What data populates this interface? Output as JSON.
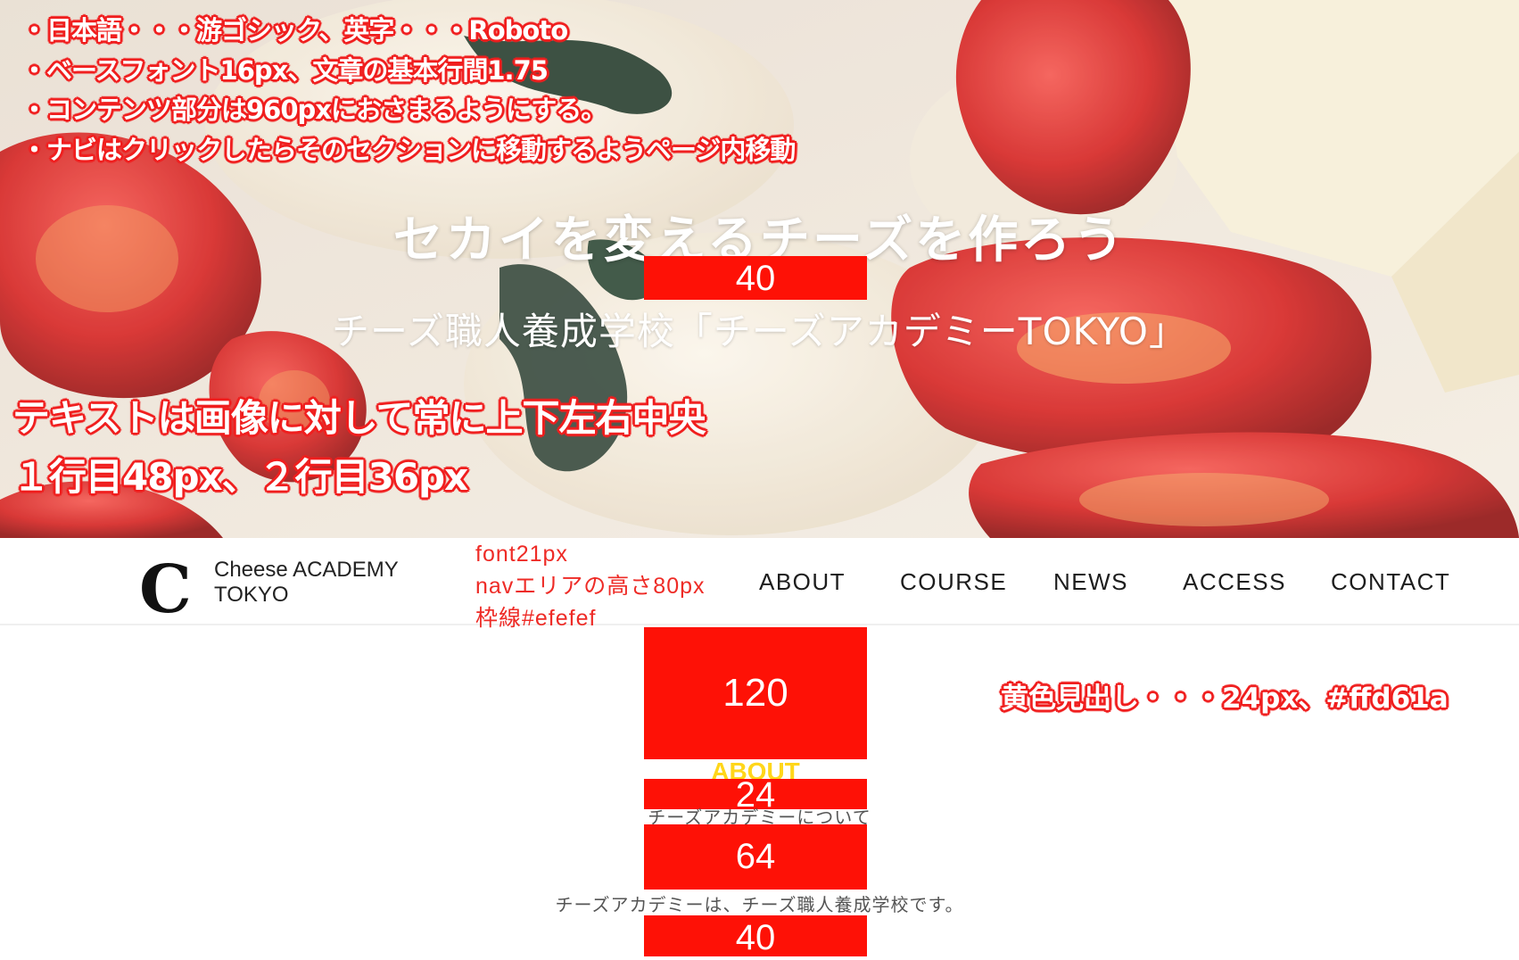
{
  "annotations": {
    "requirements": [
      "・日本語・・・游ゴシック、英字・・・Roboto",
      "・ベースフォント16px、文章の基本行間1.75",
      "・コンテンツ部分は960pxにおさまるようにする。",
      "・ナビはクリックしたらそのセクションに移動するようページ内移動"
    ],
    "hero_centering": [
      "テキストは画像に対して常に上下左右中央",
      "１行目48px、２行目36px"
    ],
    "nav_spec": [
      "font21px",
      "navエリアの高さ80px",
      "枠線#efefef"
    ],
    "heading_spec": "黄色見出し・・・24px、#ffd61a"
  },
  "hero": {
    "title": "セカイを変えるチーズを作ろう",
    "subtitle": "チーズ職人養成学校「チーズアカデミーTOKYO」"
  },
  "spacing_labels": {
    "hero_gap": "40",
    "section_top": "120",
    "heading_gap": "24",
    "subheading_gap": "64",
    "body_gap": "40"
  },
  "nav": {
    "logo_mark": "C",
    "logo_line1": "Cheese ACADEMY",
    "logo_line2": "TOKYO",
    "items": [
      {
        "label": "ABOUT"
      },
      {
        "label": "COURSE"
      },
      {
        "label": "NEWS"
      },
      {
        "label": "ACCESS"
      },
      {
        "label": "CONTACT"
      }
    ]
  },
  "about": {
    "heading": "ABOUT",
    "subheading": "チーズアカデミーについて",
    "body": "チーズアカデミーは、チーズ職人養成学校です。"
  },
  "colors": {
    "annotation_red": "#f01e1e",
    "spacer_red": "#fe1106",
    "heading_yellow": "#ffd61a",
    "nav_border": "#efefef"
  }
}
